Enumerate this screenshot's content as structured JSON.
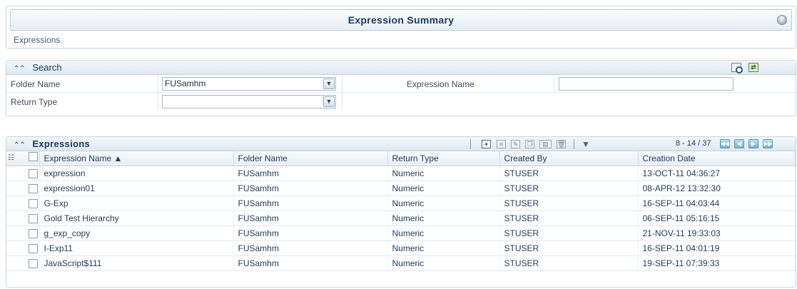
{
  "page": {
    "title": "Expression Summary",
    "breadcrumb": "Expressions"
  },
  "search": {
    "section_title": "Search",
    "folder_label": "Folder Name",
    "folder_value": "FUSamhm",
    "expression_name_label": "Expression Name",
    "expression_name_value": "",
    "return_type_label": "Return Type",
    "return_type_value": ""
  },
  "grid": {
    "section_title": "Expressions",
    "pager": "8 - 14 / 37",
    "columns": [
      "Expression Name ▲",
      "Folder Name",
      "Return Type",
      "Created By",
      "Creation Date"
    ],
    "rows": [
      [
        "expression",
        "FUSamhm",
        "Numeric",
        "STUSER",
        "13-OCT-11 04:36:27"
      ],
      [
        "expression01",
        "FUSamhm",
        "Numeric",
        "STUSER",
        "08-APR-12 13:32:30"
      ],
      [
        "G-Exp",
        "FUSamhm",
        "Numeric",
        "STUSER",
        "16-SEP-11 04:03:44"
      ],
      [
        "Gold Test Hierarchy",
        "FUSamhm",
        "Numeric",
        "STUSER",
        "06-SEP-11 05:16:15"
      ],
      [
        "g_exp_copy",
        "FUSamhm",
        "Numeric",
        "STUSER",
        "21-NOV-11 19:33:03"
      ],
      [
        "I-Exp11",
        "FUSamhm",
        "Numeric",
        "STUSER",
        "16-SEP-11 04:01:19"
      ],
      [
        "JavaScript$111",
        "FUSamhm",
        "Numeric",
        "STUSER",
        "19-SEP-11 07:39:33"
      ]
    ]
  },
  "icons": {
    "help": "help-icon",
    "collapse": "double-chevron-up-icon",
    "search": "search-icon",
    "reset": "reset-icon",
    "add": "add-icon",
    "view": "view-icon",
    "edit": "edit-icon",
    "copy": "copy-icon",
    "properties": "properties-icon",
    "delete": "delete-icon",
    "filter": "filter-icon",
    "tree": "hierarchy-icon",
    "first": "first-page-icon",
    "prev": "previous-page-icon",
    "next": "next-page-icon",
    "last": "last-page-icon"
  },
  "colors": {
    "header_text": "#1b3b60",
    "pager_button": "#77b3cf"
  }
}
